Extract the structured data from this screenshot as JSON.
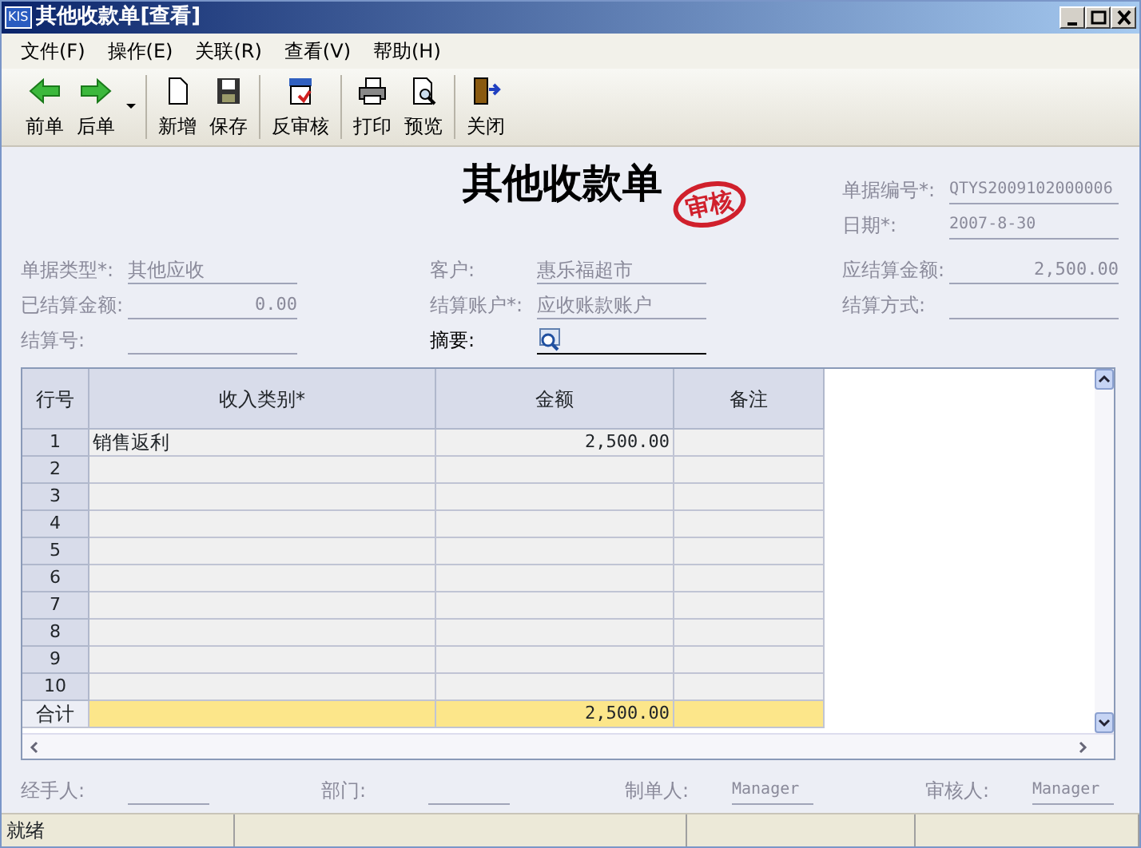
{
  "window": {
    "logo": "KIS",
    "title": "其他收款单[查看]"
  },
  "menu": [
    "文件(F)",
    "操作(E)",
    "关联(R)",
    "查看(V)",
    "帮助(H)"
  ],
  "toolbar": [
    [
      {
        "kind": "prev",
        "label": "前单"
      },
      {
        "kind": "next",
        "label": "后单",
        "dropdown": true
      }
    ],
    [
      {
        "kind": "new",
        "label": "新增"
      },
      {
        "kind": "save",
        "label": "保存"
      }
    ],
    [
      {
        "kind": "unaudit",
        "label": "反审核"
      }
    ],
    [
      {
        "kind": "print",
        "label": "打印"
      },
      {
        "kind": "preview",
        "label": "预览"
      }
    ],
    [
      {
        "kind": "close",
        "label": "关闭"
      }
    ]
  ],
  "form": {
    "title": "其他收款单",
    "stamp": "审核",
    "header_fields": [
      {
        "label": "单据编号*:",
        "value": "QTYS2009102000006"
      },
      {
        "label": "日期*:",
        "value": "2007-8-30"
      }
    ],
    "fields": [
      {
        "label": "单据类型*:",
        "value": "其他应收"
      },
      {
        "label": "客户:",
        "value": "惠乐福超市"
      },
      {
        "label": "应结算金额:",
        "value": "2,500.00",
        "kind": "amount"
      },
      {
        "label": "已结算金额:",
        "value": "0.00",
        "kind": "amount"
      },
      {
        "label": "结算账户*:",
        "value": "应收账款账户"
      },
      {
        "label": "结算方式:"
      },
      {
        "label": "结算号:"
      },
      {
        "label": "摘要:",
        "kind": "lookup",
        "editable": true
      }
    ]
  },
  "table": {
    "columns": [
      "行号",
      "收入类别*",
      "金额",
      "备注"
    ],
    "rows": [
      {
        "row": "1",
        "category": "销售返利",
        "amount": "2,500.00"
      },
      {
        "row": "2"
      },
      {
        "row": "3"
      },
      {
        "row": "4"
      },
      {
        "row": "5"
      },
      {
        "row": "6"
      },
      {
        "row": "7"
      },
      {
        "row": "8"
      },
      {
        "row": "9"
      },
      {
        "row": "10"
      }
    ],
    "total": {
      "label": "合计",
      "amount": "2,500.00"
    }
  },
  "footer": [
    {
      "label": "经手人:"
    },
    {
      "label": "部门:"
    },
    {
      "label": "制单人:",
      "value": "Manager"
    },
    {
      "label": "审核人:",
      "value": "Manager"
    }
  ],
  "status_bar": [
    "就绪"
  ]
}
